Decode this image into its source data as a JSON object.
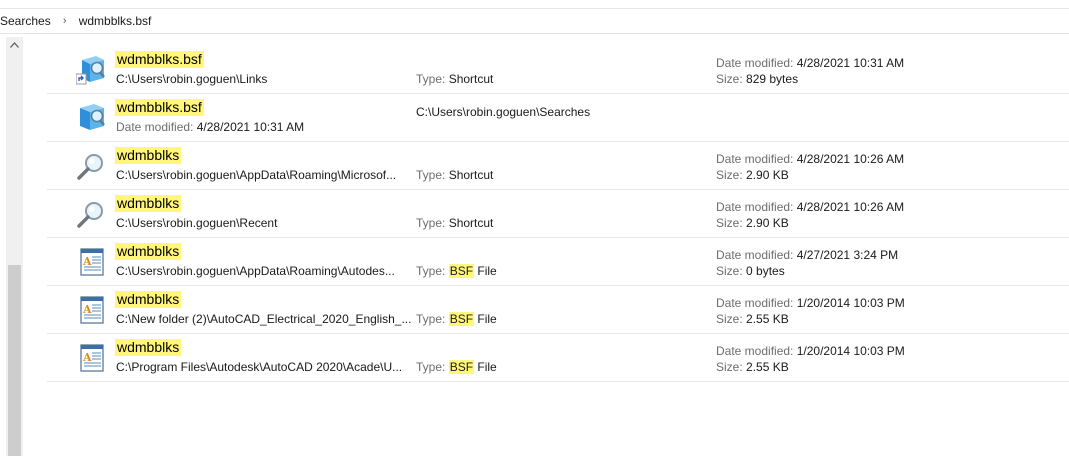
{
  "breadcrumb": {
    "root": "Searches",
    "current": "wdmbblks.bsf"
  },
  "labels": {
    "date_modified": "Date modified:",
    "size": "Size:",
    "type": "Type:"
  },
  "rows": [
    {
      "icon": "search-shortcut-icon",
      "name": "wdmbblks.bsf",
      "path": "C:\\Users\\robin.goguen\\Links",
      "type_hl": "",
      "type": "Shortcut",
      "date": "4/28/2021 10:31 AM",
      "size": "829 bytes"
    },
    {
      "icon": "saved-search-icon",
      "name": "wdmbblks.bsf",
      "date_label": "Date modified:",
      "date": "4/28/2021 10:31 AM",
      "location": "C:\\Users\\robin.goguen\\Searches"
    },
    {
      "icon": "magnifier-icon",
      "name": "wdmbblks",
      "path": "C:\\Users\\robin.goguen\\AppData\\Roaming\\Microsof...",
      "type_hl": "",
      "type": "Shortcut",
      "date": "4/28/2021 10:26 AM",
      "size": "2.90 KB"
    },
    {
      "icon": "magnifier-icon",
      "name": "wdmbblks",
      "path": "C:\\Users\\robin.goguen\\Recent",
      "type_hl": "",
      "type": "Shortcut",
      "date": "4/28/2021 10:26 AM",
      "size": "2.90 KB"
    },
    {
      "icon": "document-icon",
      "name": "wdmbblks",
      "path": "C:\\Users\\robin.goguen\\AppData\\Roaming\\Autodes...",
      "type_hl": "BSF",
      "type": " File",
      "date": "4/27/2021 3:24 PM",
      "size": "0 bytes"
    },
    {
      "icon": "document-icon",
      "name": "wdmbblks",
      "path": "C:\\New folder (2)\\AutoCAD_Electrical_2020_English_...",
      "type_hl": "BSF",
      "type": " File",
      "date": "1/20/2014 10:03 PM",
      "size": "2.55 KB"
    },
    {
      "icon": "document-icon",
      "name": "wdmbblks",
      "path": "C:\\Program Files\\Autodesk\\AutoCAD 2020\\Acade\\U...",
      "type_hl": "BSF",
      "type": " File",
      "date": "1/20/2014 10:03 PM",
      "size": "2.55 KB"
    }
  ]
}
